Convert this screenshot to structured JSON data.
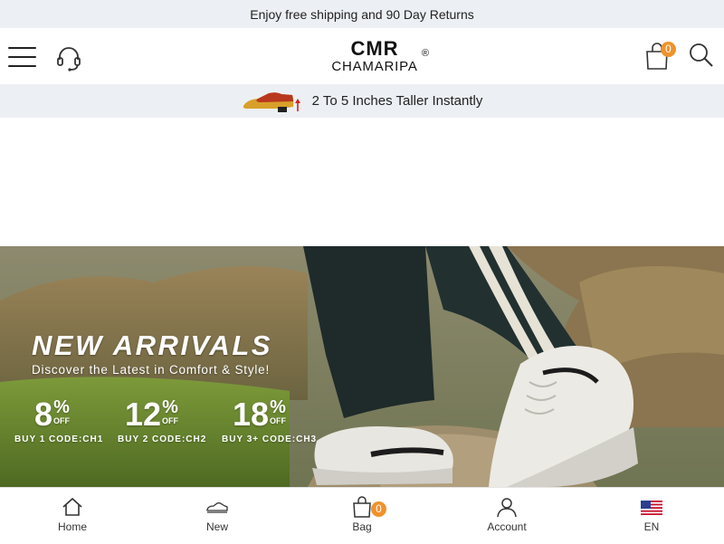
{
  "topbar": {
    "text": "Enjoy free shipping and 90 Day Returns"
  },
  "header": {
    "logo_line1": "CMR",
    "logo_line2": "CHAMARIPA",
    "logo_mark": "®",
    "cart_count": "0",
    "icons": [
      "menu-icon",
      "headset-icon",
      "shopping-bag-icon",
      "search-icon"
    ]
  },
  "promo": {
    "text": "2 To 5 Inches Taller Instantly"
  },
  "hero": {
    "title": "NEW ARRIVALS",
    "subtitle": "Discover the Latest in Comfort & Style!",
    "offers": [
      {
        "value": "8",
        "pct": "%",
        "off": "OFF",
        "code": "BUY 1  CODE:CH1"
      },
      {
        "value": "12",
        "pct": "%",
        "off": "OFF",
        "code": "BUY 2  CODE:CH2"
      },
      {
        "value": "18",
        "pct": "%",
        "off": "OFF",
        "code": "BUY 3+  CODE:CH3"
      }
    ]
  },
  "bottom_nav": {
    "items": [
      {
        "label": "Home",
        "icon": "home-icon"
      },
      {
        "label": "New",
        "icon": "shoe-icon"
      },
      {
        "label": "Bag",
        "icon": "bag-icon",
        "badge": "0"
      },
      {
        "label": "Account",
        "icon": "user-icon"
      },
      {
        "label": "EN",
        "icon": "us-flag-icon"
      }
    ]
  },
  "colors": {
    "accent": "#f0922b",
    "bar_bg": "#eceff3"
  }
}
